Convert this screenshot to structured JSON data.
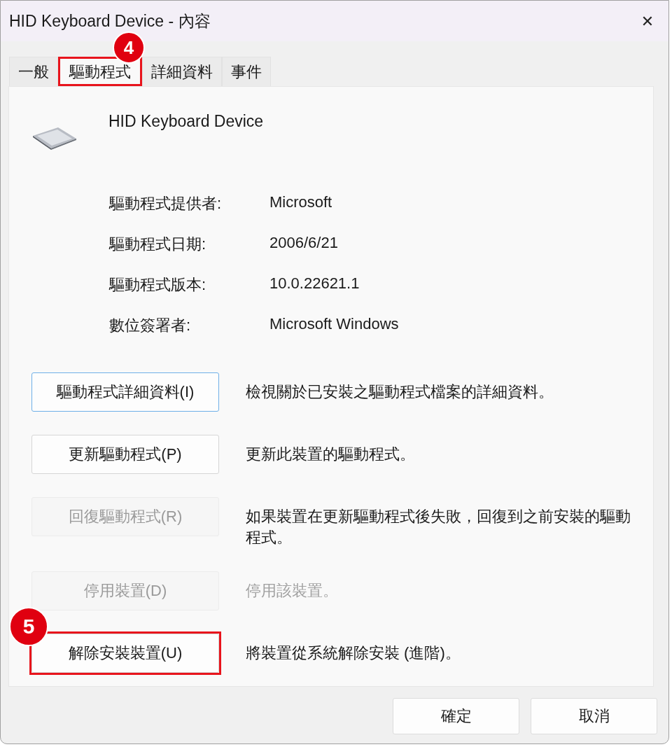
{
  "window": {
    "title": "HID Keyboard Device - 內容",
    "close": "✕"
  },
  "tabs": [
    {
      "label": "一般",
      "selected": false
    },
    {
      "label": "驅動程式",
      "selected": true,
      "callout": "4"
    },
    {
      "label": "詳細資料",
      "selected": false
    },
    {
      "label": "事件",
      "selected": false
    }
  ],
  "device": {
    "name": "HID Keyboard Device"
  },
  "properties": [
    {
      "label": "驅動程式提供者:",
      "value": "Microsoft"
    },
    {
      "label": "驅動程式日期:",
      "value": "2006/6/21"
    },
    {
      "label": "驅動程式版本:",
      "value": "10.0.22621.1"
    },
    {
      "label": "數位簽署者:",
      "value": "Microsoft Windows"
    }
  ],
  "actions": [
    {
      "button": "驅動程式詳細資料(I)",
      "description": "檢視關於已安裝之驅動程式檔案的詳細資料。",
      "disabled": false,
      "focused": true,
      "description_disabled": false
    },
    {
      "button": "更新驅動程式(P)",
      "description": "更新此裝置的驅動程式。",
      "disabled": false,
      "focused": false,
      "description_disabled": false
    },
    {
      "button": "回復驅動程式(R)",
      "description": "如果裝置在更新驅動程式後失敗，回復到之前安裝的驅動程式。",
      "disabled": true,
      "focused": false,
      "description_disabled": false
    },
    {
      "button": "停用裝置(D)",
      "description": "停用該裝置。",
      "disabled": true,
      "focused": false,
      "description_disabled": true
    },
    {
      "button": "解除安裝裝置(U)",
      "description": "將裝置從系統解除安裝 (進階)。",
      "disabled": false,
      "focused": false,
      "description_disabled": false,
      "callout": "5"
    }
  ],
  "footer_buttons": [
    "確定",
    "取消"
  ]
}
